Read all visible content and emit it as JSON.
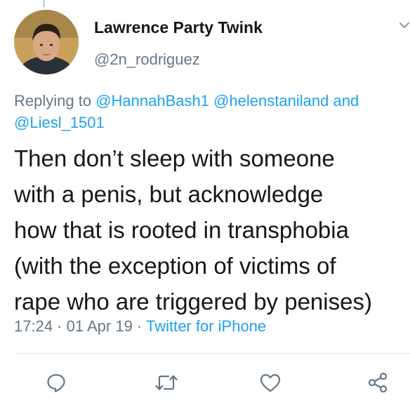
{
  "author": {
    "display_name": "Lawrence Party Twink",
    "handle": "@2n_rodriguez"
  },
  "reply": {
    "prefix": "Replying to",
    "mentions": [
      "@HannahBash1",
      "@helenstaniland"
    ],
    "joiner": "and",
    "last_mention": "@Liesl_1501"
  },
  "tweet": {
    "text": "Then don’t sleep with someone\nwith a penis, but acknowledge\nhow that is rooted in transphobia\n(with the exception of victims of\nrape who are triggered by penises)"
  },
  "meta": {
    "time": "17:24",
    "sep1": " · ",
    "date": "01 Apr 19",
    "sep2": " · ",
    "source": "Twitter for iPhone"
  },
  "actions": {
    "icons": [
      "reply-icon",
      "retweet-icon",
      "like-icon",
      "share-icon"
    ]
  },
  "colors": {
    "link_blue": "#1da1f2",
    "secondary_gray": "#657786",
    "text_dark": "#14171a"
  }
}
